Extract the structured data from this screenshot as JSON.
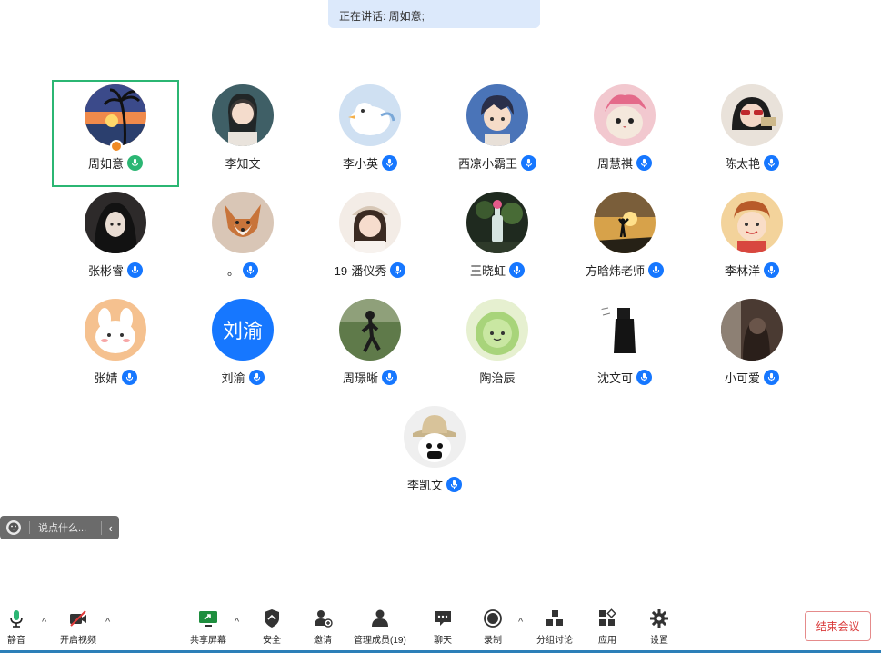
{
  "speaking": {
    "text": "正在讲话: 周如意;"
  },
  "participants": [
    {
      "name": "周如意",
      "avatar_icon": "sunset-palm-avatar",
      "mic": "green",
      "host": true,
      "active": true
    },
    {
      "name": "李知文",
      "avatar_icon": "girl-photo-avatar",
      "mic": "none"
    },
    {
      "name": "李小英",
      "avatar_icon": "cartoon-bird-avatar",
      "mic": "blue"
    },
    {
      "name": "西凉小霸王",
      "avatar_icon": "anime-boy-avatar",
      "mic": "blue"
    },
    {
      "name": "周慧祺",
      "avatar_icon": "cat-avatar",
      "mic": "blue"
    },
    {
      "name": "陈太艳",
      "avatar_icon": "sunglasses-girl-avatar",
      "mic": "blue"
    },
    {
      "name": "张彬睿",
      "avatar_icon": "anime-girl-avatar",
      "mic": "blue"
    },
    {
      "name": "。",
      "avatar_icon": "fox-avatar",
      "mic": "blue"
    },
    {
      "name": "19-潘仪秀",
      "avatar_icon": "girl-hat-avatar",
      "mic": "blue"
    },
    {
      "name": "王晓虹",
      "avatar_icon": "bottle-night-avatar",
      "mic": "blue"
    },
    {
      "name": "方晗炜老师",
      "avatar_icon": "silhouette-sunset-avatar",
      "mic": "blue"
    },
    {
      "name": "李林洋",
      "avatar_icon": "cartoon-kid-avatar",
      "mic": "blue"
    },
    {
      "name": "张婧",
      "avatar_icon": "bunny-avatar",
      "mic": "blue"
    },
    {
      "name": "刘渝",
      "avatar_text": "刘渝",
      "avatar_icon": "text-avatar",
      "mic": "blue"
    },
    {
      "name": "周璟晰",
      "avatar_icon": "walking-person-avatar",
      "mic": "blue"
    },
    {
      "name": "陶治辰",
      "avatar_icon": "cabbage-avatar",
      "mic": "none"
    },
    {
      "name": "沈文可",
      "avatar_icon": "sketch-figure-avatar",
      "mic": "blue"
    },
    {
      "name": "小可爱",
      "avatar_icon": "dark-portrait-avatar",
      "mic": "blue"
    },
    {
      "name": "李凯文",
      "avatar_icon": "hat-mask-avatar",
      "mic": "blue"
    }
  ],
  "chat": {
    "placeholder": "说点什么..."
  },
  "toolbar": {
    "mute": "静音",
    "video": "开启视频",
    "share": "共享屏幕",
    "security": "安全",
    "invite": "邀请",
    "members": "管理成员(19)",
    "chat": "聊天",
    "record": "录制",
    "breakout": "分组讨论",
    "apps": "应用",
    "settings": "设置",
    "end": "结束会议"
  },
  "colors": {
    "accent": "#1677ff",
    "active_border": "#2bb673",
    "end": "#d93838"
  }
}
